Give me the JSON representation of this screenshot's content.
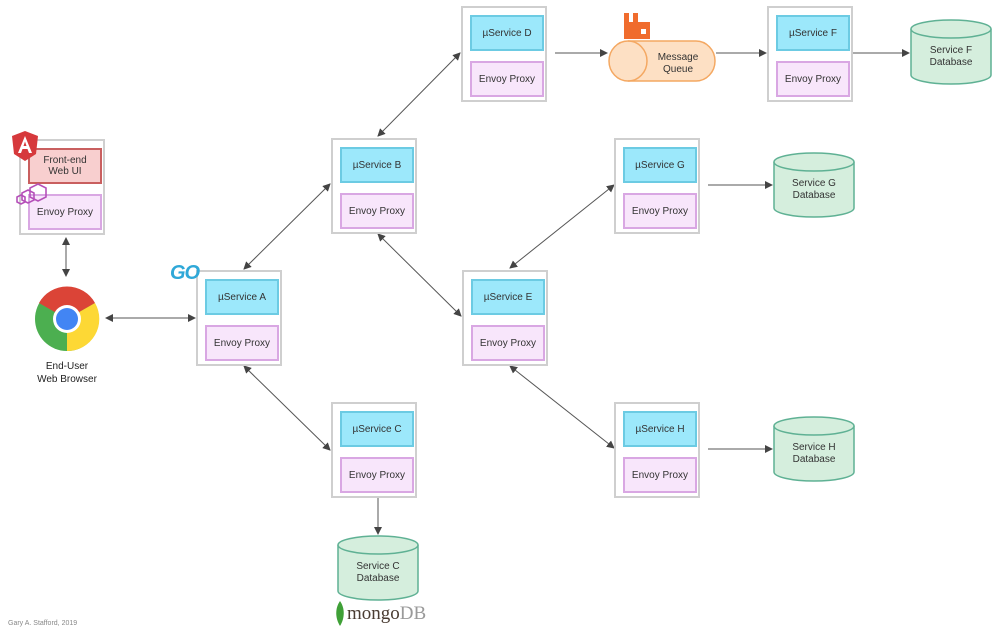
{
  "diagram": {
    "frontend": {
      "label": "Front-end Web UI",
      "line1": "Front-end",
      "line2": "Web UI",
      "proxy": "Envoy Proxy"
    },
    "browser": {
      "line1": "End-User",
      "line2": "Web Browser"
    },
    "services": [
      {
        "id": "A",
        "label": "µService A",
        "proxy": "Envoy Proxy"
      },
      {
        "id": "B",
        "label": "µService B",
        "proxy": "Envoy Proxy"
      },
      {
        "id": "C",
        "label": "µService C",
        "proxy": "Envoy Proxy"
      },
      {
        "id": "D",
        "label": "µService D",
        "proxy": "Envoy Proxy"
      },
      {
        "id": "E",
        "label": "µService E",
        "proxy": "Envoy Proxy"
      },
      {
        "id": "F",
        "label": "µService F",
        "proxy": "Envoy Proxy"
      },
      {
        "id": "G",
        "label": "µService G",
        "proxy": "Envoy Proxy"
      },
      {
        "id": "H",
        "label": "µService H",
        "proxy": "Envoy Proxy"
      }
    ],
    "queue": {
      "line1": "Message",
      "line2": "Queue"
    },
    "databases": [
      {
        "id": "C",
        "line1": "Service C",
        "line2": "Database"
      },
      {
        "id": "F",
        "line1": "Service F",
        "line2": "Database"
      },
      {
        "id": "G",
        "line1": "Service G",
        "line2": "Database"
      },
      {
        "id": "H",
        "line1": "Service H",
        "line2": "Database"
      }
    ],
    "logos": {
      "angular": "angular-icon",
      "envoy": "envoy-icon",
      "chrome": "chrome-icon",
      "go": "GO",
      "rabbitmq": "rabbitmq-icon",
      "mongodb_text1": "mongo",
      "mongodb_text2": "DB"
    },
    "credit": "Gary A. Stafford, 2019",
    "colors": {
      "service": "#9ce8fb",
      "proxy": "#f8e6fb",
      "frontend": "#f8cfcf",
      "database": "#d5eedd",
      "queue": "#fde0c4"
    }
  }
}
